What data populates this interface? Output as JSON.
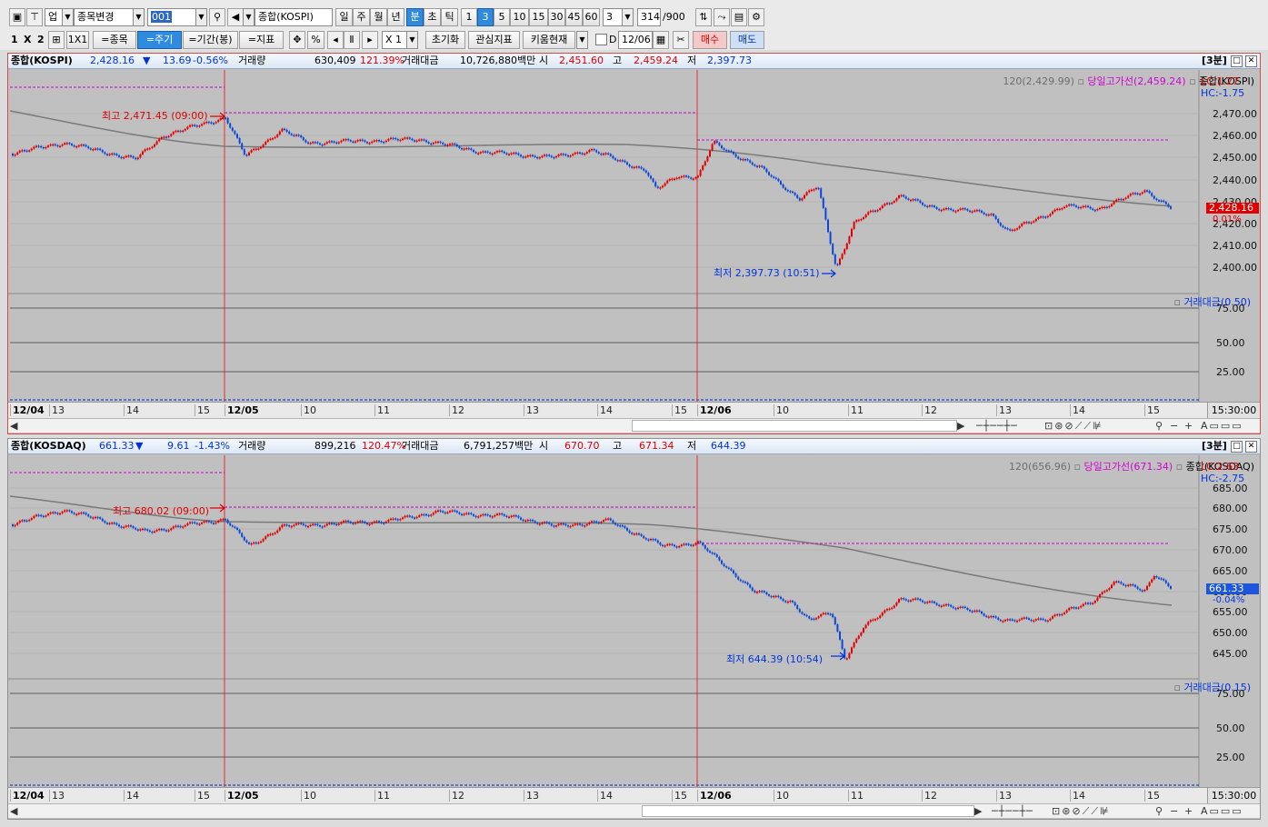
{
  "toolbar1": {
    "market": "업",
    "symbol_change": "종목변경",
    "code": "001",
    "index_name": "종합(KOSPI)",
    "periods": [
      "일",
      "주",
      "월",
      "년",
      "분",
      "초",
      "틱"
    ],
    "nums": [
      "1",
      "3",
      "5",
      "10",
      "15",
      "30",
      "45",
      "60"
    ],
    "n_value": "3",
    "count": "314",
    "count_max": "/900"
  },
  "toolbar2": {
    "layout_1": "1",
    "layout_x": "X",
    "layout_2": "2",
    "layout_1x1": "1X1",
    "eq_stock": "=종목",
    "eq_period": "=주기",
    "eq_term": "=기간(봉)",
    "eq_indicator": "=지표",
    "pct": "%",
    "speed": "X 1",
    "reset": "초기화",
    "interest": "관심지표",
    "kiwoom": "키움현재",
    "d_label": "D",
    "date": "12/06",
    "buy": "매수",
    "sell": "매도"
  },
  "panels": [
    {
      "header": {
        "name": "종합(KOSPI)",
        "price": "2,428.16",
        "arrow": "▼",
        "change": "13.69",
        "rate": "-0.56%",
        "vol_label": "거래량",
        "vol": "630,409",
        "vol_ratio": "121.39%",
        "amt_label": "거래대금",
        "amt": "10,726,880백만",
        "open_label": "시",
        "open": "2,451.60",
        "high_label": "고",
        "high": "2,459.24",
        "low_label": "저",
        "low": "2,397.73",
        "period": "[3분]"
      },
      "legend": {
        "ma": "120(2,429.99)",
        "high_line": "당일고가선(2,459.24)",
        "symbol": "종합(KOSPI)",
        "lc": "LC:1.27",
        "hc": "HC:-1.75"
      },
      "last_price": "2,428.16",
      "last_pct": "0.01%",
      "annotations": {
        "high": "최고 2,471.45 (09:00)",
        "low": "최저 2,397.73 (10:51)"
      },
      "y_labels": [
        "2,470.00",
        "2,460.00",
        "2,450.00",
        "2,440.00",
        "2,430.00",
        "2,420.00",
        "2,410.00",
        "2,400.00"
      ],
      "indicator": "거래대금(0.50)",
      "ind_labels": [
        "75.00",
        "50.00",
        "25.00"
      ],
      "x_labels": [
        "12/04",
        "13",
        "14",
        "15",
        "12/05",
        "10",
        "11",
        "12",
        "13",
        "14",
        "15",
        "12/06",
        "10",
        "11",
        "12",
        "13",
        "14",
        "15"
      ],
      "time": "15:30:00"
    },
    {
      "header": {
        "name": "종합(KOSDAQ)",
        "price": "661.33",
        "arrow": "▼",
        "change": "9.61",
        "rate": "-1.43%",
        "vol_label": "거래량",
        "vol": "899,216",
        "vol_ratio": "120.47%",
        "amt_label": "거래대금",
        "amt": "6,791,257백만",
        "open_label": "시",
        "open": "670.70",
        "high_label": "고",
        "high": "671.34",
        "low_label": "저",
        "low": "644.39",
        "period": "[3분]"
      },
      "legend": {
        "ma": "120(656.96)",
        "high_line": "당일고가선(671.34)",
        "symbol": "종합(KOSDAQ)",
        "lc": "LC:2.63",
        "hc": "HC:-2.75"
      },
      "last_price": "661.33",
      "last_pct": "-0.04%",
      "annotations": {
        "high": "최고 680.02 (09:00)",
        "low": "최저 644.39 (10:54)"
      },
      "y_labels": [
        "685.00",
        "680.00",
        "675.00",
        "670.00",
        "665.00",
        "660.00",
        "655.00",
        "650.00",
        "645.00"
      ],
      "indicator": "거래대금(0.15)",
      "ind_labels": [
        "75.00",
        "50.00",
        "25.00"
      ],
      "x_labels": [
        "12/04",
        "13",
        "14",
        "15",
        "12/05",
        "10",
        "11",
        "12",
        "13",
        "14",
        "15",
        "12/06",
        "10",
        "11",
        "12",
        "13",
        "14",
        "15"
      ],
      "time": "15:30:00"
    }
  ],
  "colors": {
    "up": "#e00000",
    "down": "#0b46d8",
    "ma": "#7a7a7a",
    "high_line": "#d400d4",
    "panel_bg": "#c0c0c0"
  }
}
